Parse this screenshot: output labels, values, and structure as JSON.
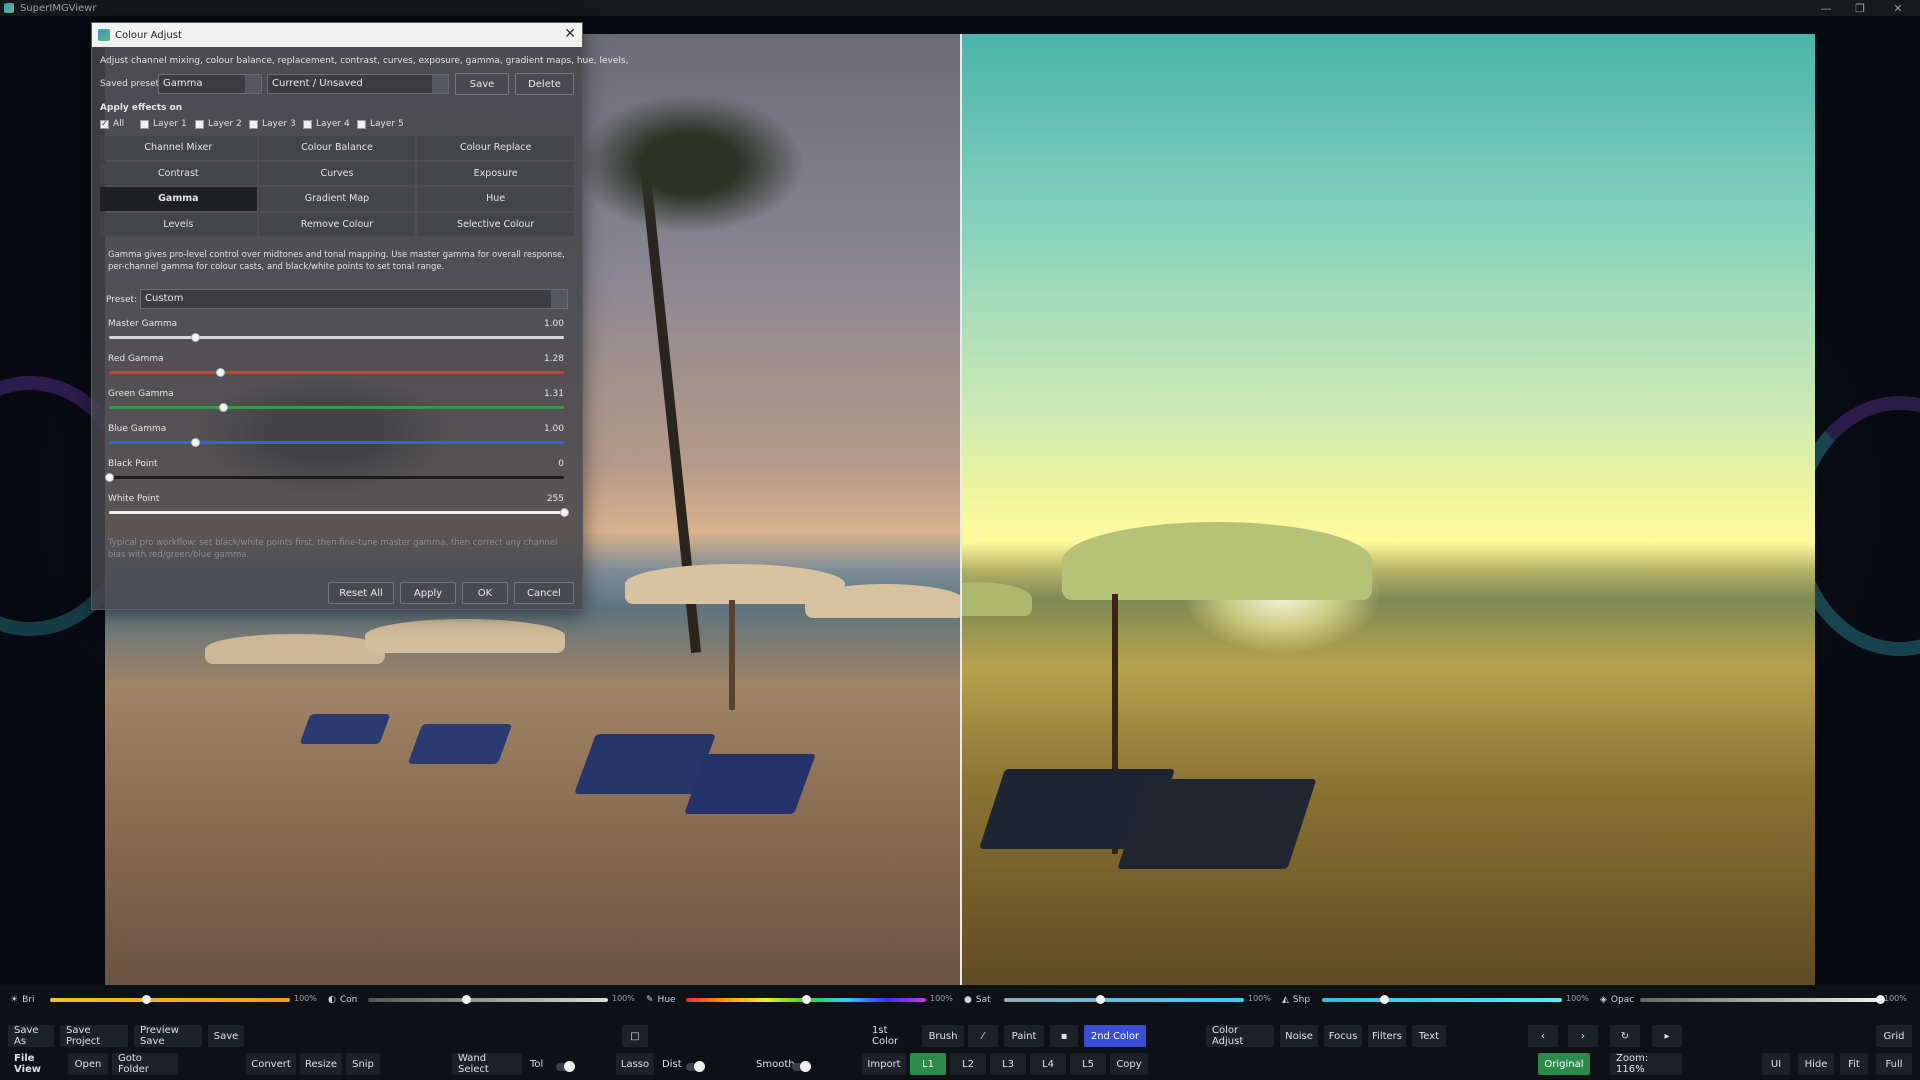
{
  "window": {
    "title": "SuperIMGViewr",
    "minimize": "—",
    "maximize": "❐",
    "close": "✕"
  },
  "dialog": {
    "title": "Colour Adjust",
    "intro": "Adjust channel mixing, colour balance, replacement, contrast, curves, exposure, gamma, gradient maps, hue, levels,",
    "saved_preset_label": "Saved preset:",
    "saved_preset_value": "Gamma",
    "current_value": "Current / Unsaved",
    "save_label": "Save",
    "delete_label": "Delete",
    "apply_effects_label": "Apply effects on",
    "layers": [
      {
        "label": "All",
        "checked": true
      },
      {
        "label": "Layer 1",
        "checked": false
      },
      {
        "label": "Layer 2",
        "checked": false
      },
      {
        "label": "Layer 3",
        "checked": false
      },
      {
        "label": "Layer 4",
        "checked": false
      },
      {
        "label": "Layer 5",
        "checked": false
      }
    ],
    "effects": [
      "Channel Mixer",
      "Colour Balance",
      "Colour Replace",
      "Contrast",
      "Curves",
      "Exposure",
      "Gamma",
      "Gradient Map",
      "Hue",
      "Levels",
      "Remove Colour",
      "Selective Colour"
    ],
    "active_effect": "Gamma",
    "gamma": {
      "description": "Gamma gives pro-level control over midtones and tonal mapping. Use master gamma for overall response, per-channel gamma for colour casts, and black/white points to set tonal range.",
      "preset_label": "Preset:",
      "preset_value": "Custom",
      "sliders": [
        {
          "label": "Master Gamma",
          "value": "1.00",
          "fraction": 0.19,
          "color": "#d6d6d6"
        },
        {
          "label": "Red Gamma",
          "value": "1.28",
          "fraction": 0.245,
          "color": "#d23a3a"
        },
        {
          "label": "Green Gamma",
          "value": "1.31",
          "fraction": 0.25,
          "color": "#2fa04a"
        },
        {
          "label": "Blue Gamma",
          "value": "1.00",
          "fraction": 0.19,
          "color": "#3766d0"
        },
        {
          "label": "Black Point",
          "value": "0",
          "fraction": 0.0,
          "color": "#1c1c1c"
        },
        {
          "label": "White Point",
          "value": "255",
          "fraction": 1.0,
          "color": "#f0f0f0"
        }
      ],
      "tip": "Typical pro workflow: set black/white points first, then fine-tune master gamma, then correct any channel bias with red/green/blue gamma."
    },
    "reset_all_label": "Reset All",
    "apply_label": "Apply",
    "ok_label": "OK",
    "cancel_label": "Cancel"
  },
  "adjustments": [
    {
      "label": "Bri",
      "icon": "☀",
      "pct": "100%",
      "fraction": 0.4,
      "gradient": "linear-gradient(90deg,#f0c32a,#f59b1a)"
    },
    {
      "label": "Con",
      "icon": "◐",
      "pct": "100%",
      "fraction": 0.41,
      "gradient": "linear-gradient(90deg,#555,#ddd)"
    },
    {
      "label": "Hue",
      "icon": "✎",
      "pct": "100%",
      "fraction": 0.5,
      "gradient": "linear-gradient(90deg,#e33,#f90,#ee3,#3c3,#3cf,#33e,#c3e)"
    },
    {
      "label": "Sat",
      "icon": "●",
      "pct": "100%",
      "fraction": 0.4,
      "gradient": "linear-gradient(90deg,#9ab,#3cf)"
    },
    {
      "label": "Shp",
      "icon": "◭",
      "pct": "100%",
      "fraction": 0.26,
      "gradient": "linear-gradient(90deg,#3bd,#5ef)"
    },
    {
      "label": "Opac",
      "icon": "◈",
      "pct": "100%",
      "fraction": 1.0,
      "gradient": "linear-gradient(90deg,#666,#eee)"
    }
  ],
  "toolbar": {
    "save_as": "Save As",
    "save_project": "Save Project",
    "preview_save": "Preview Save",
    "save": "Save",
    "square": "□",
    "first_color": "1st Color",
    "brush": "Brush",
    "line": "⁄",
    "paint": "Paint",
    "fill_icon": "▪",
    "second_color": "2nd Color",
    "color_adjust": "Color Adjust",
    "noise": "Noise",
    "focus": "Focus",
    "filters": "Filters",
    "text": "Text",
    "prev": "‹",
    "next": "›",
    "rotate": "↻",
    "play": "▸",
    "grid": "Grid",
    "file_view": "File View",
    "open": "Open",
    "goto_folder": "Goto Folder",
    "convert": "Convert",
    "resize": "Resize",
    "snip": "Snip",
    "wand_select": "Wand Select",
    "tol": "Tol",
    "lasso": "Lasso",
    "dist": "Dist",
    "smooth": "Smooth",
    "import": "Import",
    "layers": [
      "L1",
      "L2",
      "L3",
      "L4",
      "L5"
    ],
    "copy": "Copy",
    "original": "Original",
    "zoom": "Zoom: 116%",
    "ui": "UI",
    "hide": "Hide",
    "fit": "Fit",
    "full": "Full"
  }
}
